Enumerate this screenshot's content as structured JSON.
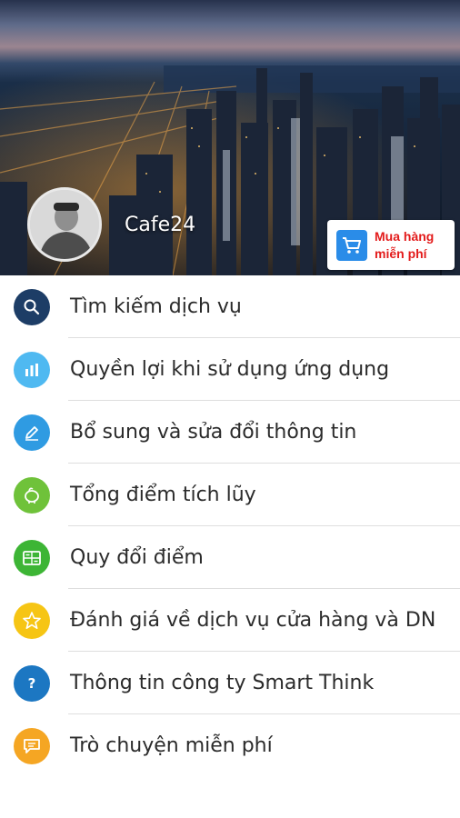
{
  "header": {
    "username": "Cafe24",
    "buy_button": {
      "line1": "Mua hàng",
      "line2": "miễn phí"
    }
  },
  "menu": [
    {
      "label": "Tìm kiếm dịch vụ",
      "icon": "search-icon",
      "color": "#1d3d66"
    },
    {
      "label": "Quyền lợi khi sử dụng ứng dụng",
      "icon": "chart-icon",
      "color": "#4fb9f1"
    },
    {
      "label": "Bổ sung và sửa đổi thông tin",
      "icon": "pencil-icon",
      "color": "#2f9be2"
    },
    {
      "label": "Tổng điểm tích lũy",
      "icon": "piggy-bank-icon",
      "color": "#6fc23a"
    },
    {
      "label": "Quy đổi điểm",
      "icon": "calculator-icon",
      "color": "#3db535"
    },
    {
      "label": "Đánh giá về dịch vụ cửa hàng và DN",
      "icon": "star-icon",
      "color": "#f6c514"
    },
    {
      "label": "Thông tin công ty Smart Think",
      "icon": "question-icon",
      "color": "#1c77c2"
    },
    {
      "label": "Trò chuyện miễn phí",
      "icon": "chat-icon",
      "color": "#f5a623"
    }
  ]
}
